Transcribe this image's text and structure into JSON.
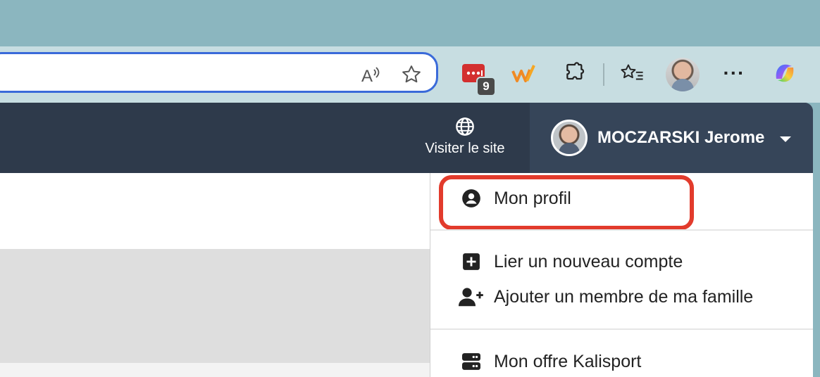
{
  "browser": {
    "toolbar": {
      "read_aloud_label": "A",
      "extension_badge_count": "9",
      "more_label": "···"
    }
  },
  "site": {
    "header": {
      "visit_label": "Visiter le site",
      "user_name": "MOCZARSKI Jerome"
    },
    "menu": {
      "profile": "Mon profil",
      "link_account": "Lier un nouveau compte",
      "add_family": "Ajouter un membre de ma famille",
      "offer": "Mon offre Kalisport"
    }
  },
  "colors": {
    "header_bg": "#2e3a4b",
    "highlight": "#e23b2c",
    "address_border": "#3a6ad9"
  }
}
